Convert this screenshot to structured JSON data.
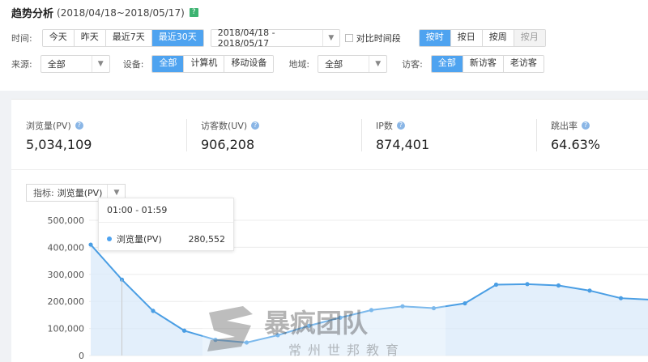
{
  "header": {
    "title": "趋势分析",
    "range": "(2018/04/18~2018/05/17)",
    "help_badge": "?"
  },
  "filters": {
    "time_label": "时间:",
    "time_buttons": [
      "今天",
      "昨天",
      "最近7天",
      "最近30天"
    ],
    "time_active": "最近30天",
    "date_range": "2018/04/18 - 2018/05/17",
    "compare_label": "对比时间段",
    "granularity": [
      "按时",
      "按日",
      "按周",
      "按月"
    ],
    "granularity_active": "按时",
    "granularity_disabled": "按月",
    "source_label": "来源:",
    "source_value": "全部",
    "device_label": "设备:",
    "device_buttons": [
      "全部",
      "计算机",
      "移动设备"
    ],
    "device_active": "全部",
    "region_label": "地域:",
    "region_value": "全部",
    "visitor_label": "访客:",
    "visitor_buttons": [
      "全部",
      "新访客",
      "老访客"
    ],
    "visitor_active": "全部"
  },
  "kpis": [
    {
      "label": "浏览量(PV)",
      "value": "5,034,109"
    },
    {
      "label": "访客数(UV)",
      "value": "906,208"
    },
    {
      "label": "IP数",
      "value": "874,401"
    },
    {
      "label": "跳出率",
      "value": "64.63%"
    }
  ],
  "metric_select": {
    "label": "指标:",
    "value": "浏览量(PV)"
  },
  "tooltip": {
    "time": "01:00 - 01:59",
    "series": "浏览量(PV)",
    "value": "280,552"
  },
  "watermark": {
    "main": "暴疯团队",
    "sub": "常州世邦教育"
  },
  "colors": {
    "accent": "#4ea3f0",
    "line": "#4a9ee4",
    "area": "#d9eafa"
  },
  "chart_data": {
    "type": "area",
    "series": [
      {
        "name": "浏览量(PV)",
        "values": [
          410000,
          280552,
          165000,
          92000,
          58000,
          48000,
          75000,
          110000,
          140000,
          168000,
          182000,
          175000,
          193000,
          262000,
          264000,
          259000,
          240000,
          212000,
          206000
        ]
      }
    ],
    "y_ticks": [
      "500,000",
      "400,000",
      "300,000",
      "200,000",
      "100,000",
      "0"
    ],
    "ylim": [
      0,
      500000
    ],
    "grid": true
  }
}
